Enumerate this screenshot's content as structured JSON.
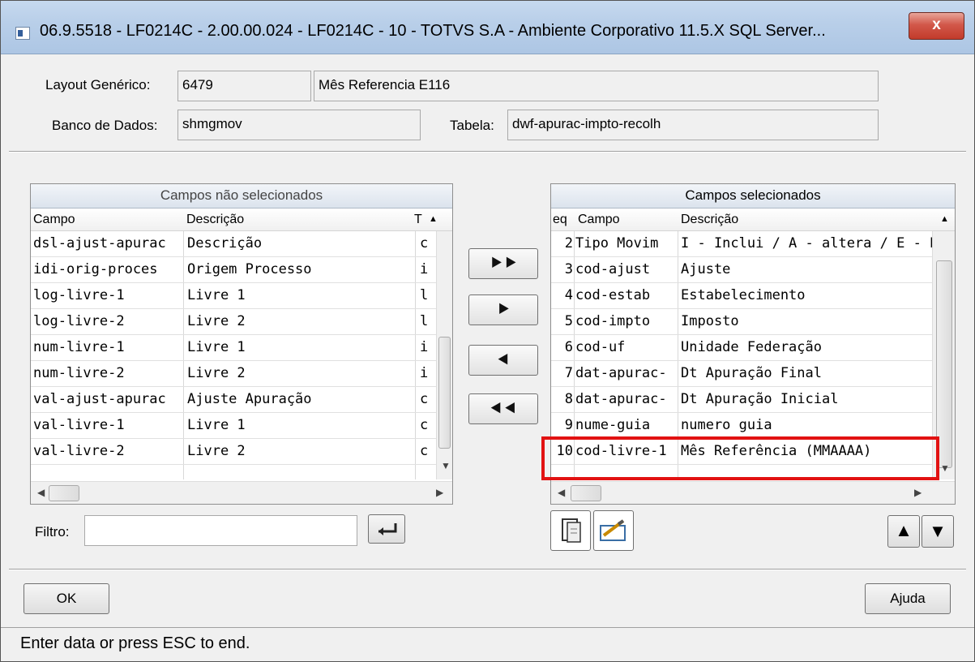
{
  "window": {
    "title": "06.9.5518 - LF0214C - 2.00.00.024 - LF0214C - 10 - TOTVS S.A - Ambiente Corporativo 11.5.X SQL Server...",
    "close_label": "x"
  },
  "form": {
    "layout_label": "Layout Genérico:",
    "layout_code": "6479",
    "layout_desc": "Mês Referencia E116",
    "db_label": "Banco de Dados:",
    "db_value": "shmgmov",
    "table_label": "Tabela:",
    "table_value": "dwf-apurac-impto-recolh"
  },
  "left_panel": {
    "title": "Campos não selecionados",
    "columns": [
      "Campo",
      "Descrição",
      "T"
    ],
    "rows": [
      {
        "campo": "dsl-ajust-apurac",
        "descricao": "Descrição",
        "t": "c"
      },
      {
        "campo": "idi-orig-proces",
        "descricao": "Origem Processo",
        "t": "i"
      },
      {
        "campo": "log-livre-1",
        "descricao": "Livre 1",
        "t": "l"
      },
      {
        "campo": "log-livre-2",
        "descricao": "Livre 2",
        "t": "l"
      },
      {
        "campo": "num-livre-1",
        "descricao": "Livre 1",
        "t": "i"
      },
      {
        "campo": "num-livre-2",
        "descricao": "Livre 2",
        "t": "i"
      },
      {
        "campo": "val-ajust-apurac",
        "descricao": "Ajuste Apuração",
        "t": "c"
      },
      {
        "campo": "val-livre-1",
        "descricao": "Livre 1",
        "t": "c"
      },
      {
        "campo": "val-livre-2",
        "descricao": "Livre 2",
        "t": "c"
      }
    ]
  },
  "right_panel": {
    "title": "Campos selecionados",
    "columns": [
      "eq",
      "Campo",
      "Descrição"
    ],
    "rows": [
      {
        "seq": "2",
        "campo": "Tipo Movim",
        "descricao": "I - Inclui / A - altera / E - El"
      },
      {
        "seq": "3",
        "campo": "cod-ajust",
        "descricao": "Ajuste"
      },
      {
        "seq": "4",
        "campo": "cod-estab",
        "descricao": "Estabelecimento"
      },
      {
        "seq": "5",
        "campo": "cod-impto",
        "descricao": "Imposto"
      },
      {
        "seq": "6",
        "campo": "cod-uf",
        "descricao": "Unidade Federação"
      },
      {
        "seq": "7",
        "campo": "dat-apurac-",
        "descricao": "Dt Apuração Final"
      },
      {
        "seq": "8",
        "campo": "dat-apurac-",
        "descricao": "Dt Apuração Inicial"
      },
      {
        "seq": "9",
        "campo": "nume-guia",
        "descricao": "numero guia"
      },
      {
        "seq": "10",
        "campo": "cod-livre-1",
        "descricao": "Mês Referência (MMAAAA)"
      }
    ]
  },
  "move_buttons": {
    "add_all": "⯈⯈",
    "add_one": "⯈",
    "remove_one": "⯇",
    "remove_all": "⯇⯇"
  },
  "filter": {
    "label": "Filtro:",
    "value": ""
  },
  "buttons": {
    "ok": "OK",
    "help": "Ajuda"
  },
  "status_text": "Enter data or press ESC to end.",
  "colors": {
    "highlight": "#e21212",
    "panel_header": "#dbe3ed"
  }
}
